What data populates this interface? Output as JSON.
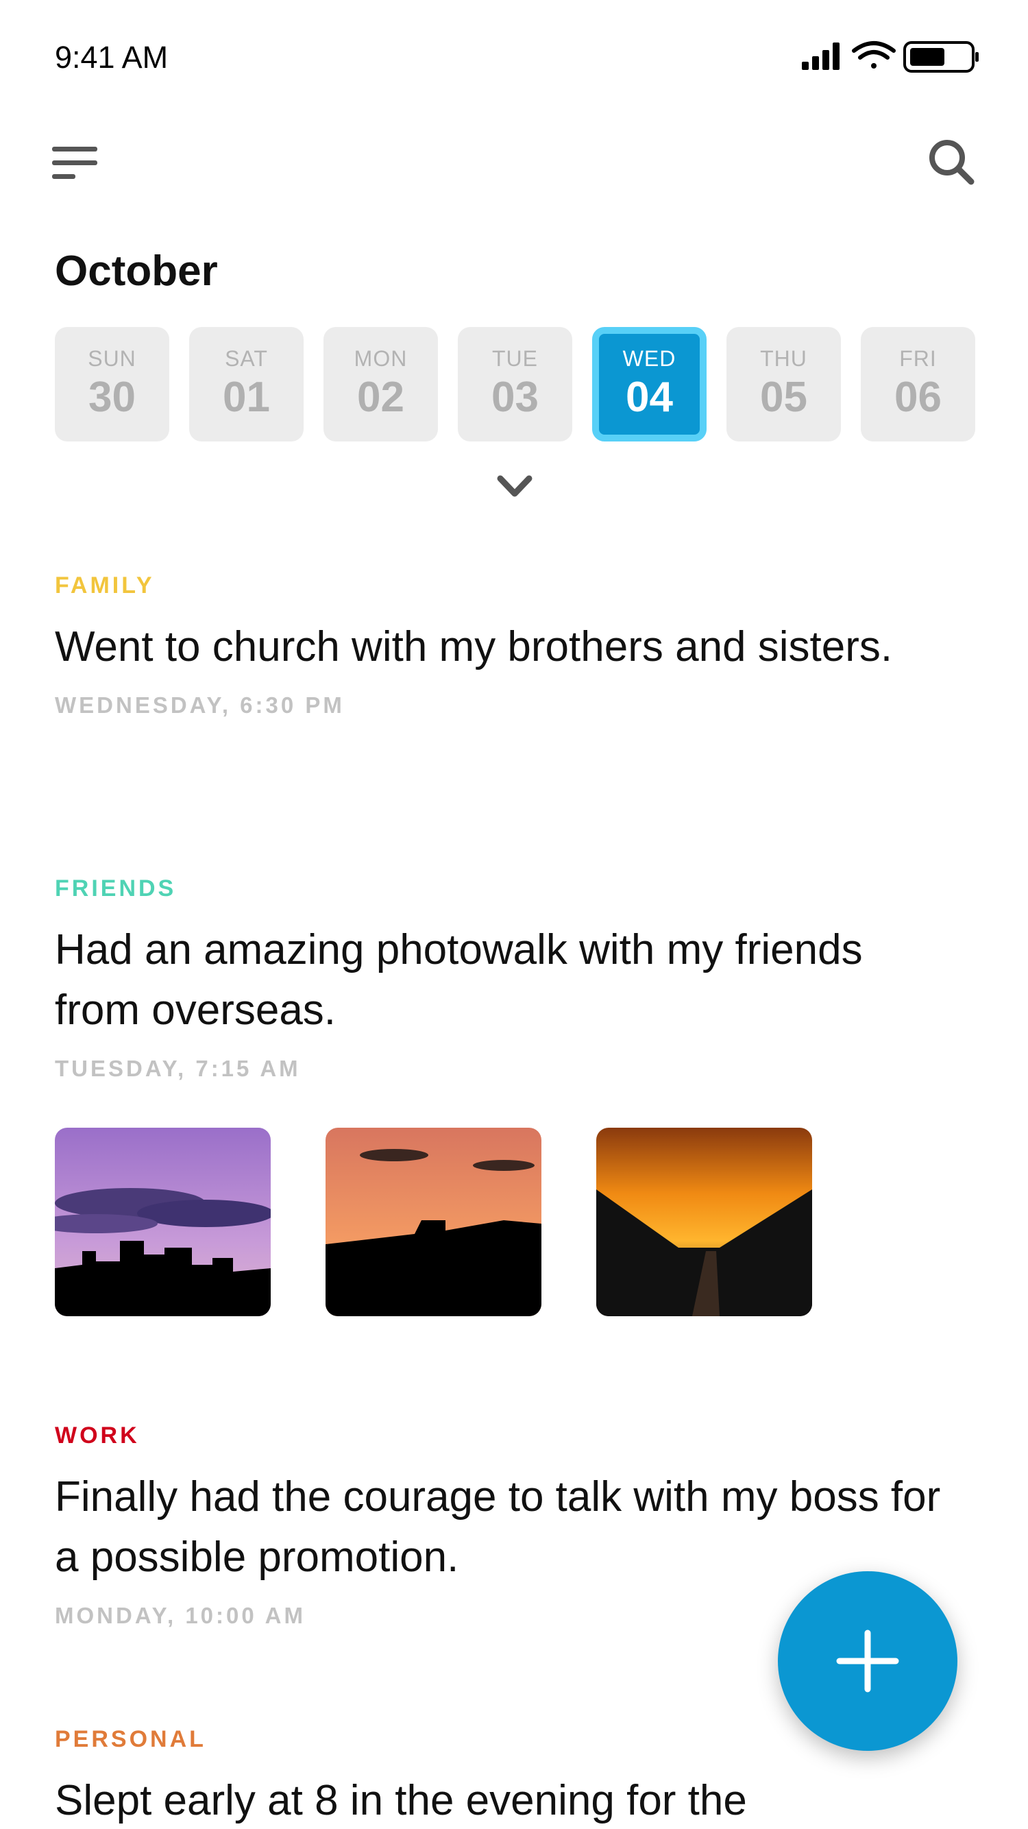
{
  "status_bar": {
    "time": "9:41 AM",
    "icons": [
      "signal-icon",
      "wifi-icon",
      "battery-icon"
    ]
  },
  "toolbar": {
    "menu_icon": "menu-icon",
    "search_icon": "search-icon"
  },
  "calendar": {
    "month": "October",
    "days": [
      {
        "dow": "SUN",
        "num": "30",
        "selected": false
      },
      {
        "dow": "SAT",
        "num": "01",
        "selected": false
      },
      {
        "dow": "MON",
        "num": "02",
        "selected": false
      },
      {
        "dow": "TUE",
        "num": "03",
        "selected": false
      },
      {
        "dow": "WED",
        "num": "04",
        "selected": true
      },
      {
        "dow": "THU",
        "num": "05",
        "selected": false
      },
      {
        "dow": "FRI",
        "num": "06",
        "selected": false
      }
    ],
    "expand_icon": "chevron-down-icon",
    "accent": "#0b97d2"
  },
  "entries": [
    {
      "category": "FAMILY",
      "color": "#f2c53d",
      "text": "Went to church with my brothers and sisters.",
      "time": "WEDNESDAY, 6:30 PM"
    },
    {
      "category": "FRIENDS",
      "color": "#4fd3b4",
      "text": "Had an amazing photowalk with my friends from overseas.",
      "time": "TUESDAY, 7:15 AM",
      "photos": [
        "purple-sky-skyline-photo",
        "orange-sky-rooftop-photo",
        "sunset-bridge-photo"
      ]
    },
    {
      "category": "WORK",
      "color": "#d0021b",
      "text": "Finally had the courage to talk with my boss for a possible promotion.",
      "time": "MONDAY, 10:00 AM"
    },
    {
      "category": "PERSONAL",
      "color": "#e07b39",
      "text": "Slept early at 8 in the evening for the"
    }
  ],
  "fab": {
    "icon": "plus-icon"
  }
}
